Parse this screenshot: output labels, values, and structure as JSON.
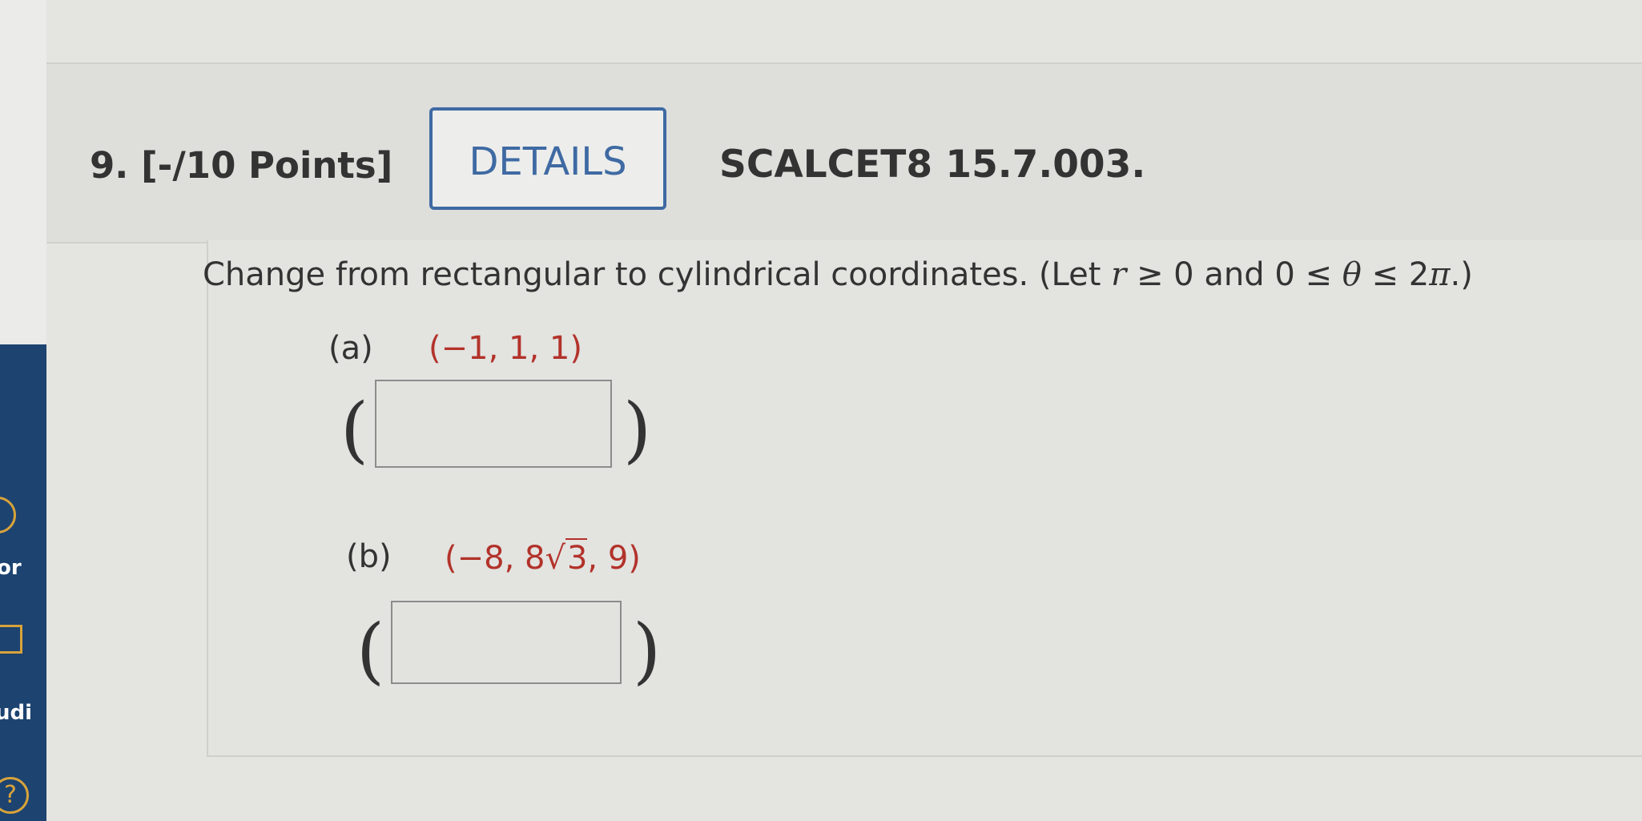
{
  "sidebar": {
    "items": [
      {
        "label": "or"
      },
      {
        "label": "udi"
      },
      {
        "label": "?"
      }
    ]
  },
  "question": {
    "number": "9.",
    "points": "[-/10 Points]",
    "details_label": "DETAILS",
    "code": "SCALCET8 15.7.003."
  },
  "problem": {
    "instruction_prefix": "Change from rectangular to cylindrical coordinates. (Let ",
    "instruction_r": "r",
    "instruction_mid": " ≥ 0 and 0 ≤ ",
    "instruction_theta": "θ",
    "instruction_end": " ≤ 2",
    "instruction_pi": "π",
    "instruction_close": ".)",
    "parts": [
      {
        "label": "(a)",
        "point": "(−1, 1, 1)",
        "answer": ""
      },
      {
        "label": "(b)",
        "point_prefix": "(−8, 8",
        "point_sqrt": "3",
        "point_suffix": ", 9)",
        "answer": ""
      }
    ],
    "open_paren": "(",
    "close_paren": ")"
  },
  "colors": {
    "accent": "#3f6aa3",
    "point_text": "#b2322a",
    "nav_bg": "#1d4370"
  }
}
